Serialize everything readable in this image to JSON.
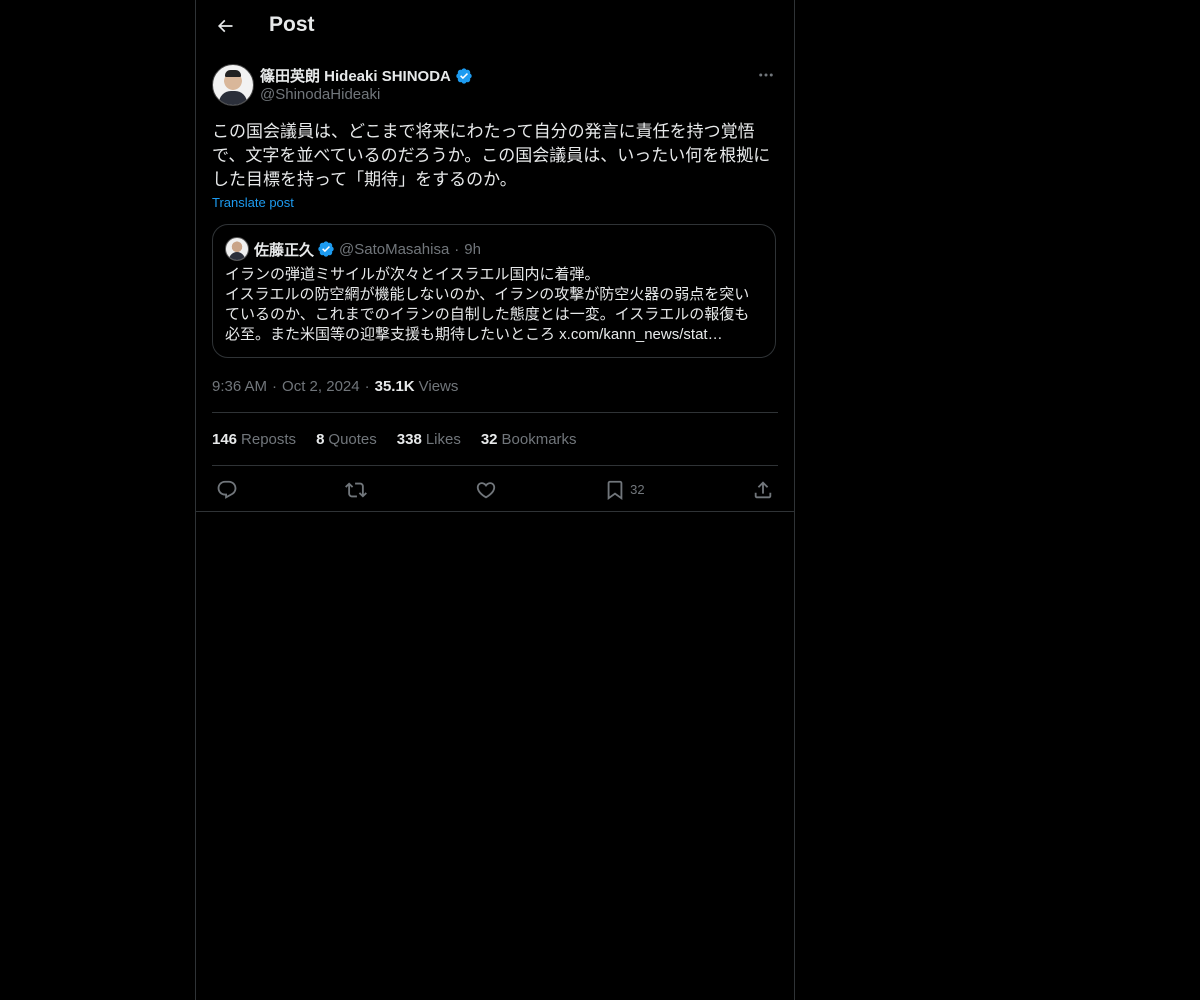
{
  "header": {
    "title": "Post"
  },
  "post": {
    "author_name": "篠田英朗 Hideaki SHINODA",
    "author_handle": "@ShinodaHideaki",
    "text": "この国会議員は、どこまで将来にわたって自分の発言に責任を持つ覚悟で、文字を並べているのだろうか。この国会議員は、いったい何を根拠にした目標を持って「期待」をするのか。",
    "translate_label": "Translate post",
    "time": "9:36 AM",
    "date": "Oct 2, 2024",
    "views_count": "35.1K",
    "views_label": "Views"
  },
  "quote": {
    "author_name": "佐藤正久",
    "author_handle": "@SatoMasahisa",
    "time": "9h",
    "text": "イランの弾道ミサイルが次々とイスラエル国内に着弾。\nイスラエルの防空網が機能しないのか、イランの攻撃が防空火器の弱点を突いているのか、これまでのイランの自制した態度とは一変。イスラエルの報復も必至。また米国等の迎撃支援も期待したいところ x.com/kann_news/stat…"
  },
  "stats": {
    "reposts_count": "146",
    "reposts_label": "Reposts",
    "quotes_count": "8",
    "quotes_label": "Quotes",
    "likes_count": "338",
    "likes_label": "Likes",
    "bookmarks_count": "32",
    "bookmarks_label": "Bookmarks"
  },
  "actions": {
    "bookmark_count": "32"
  },
  "colors": {
    "background": "#000000",
    "text": "#e7e9ea",
    "secondary": "#71767b",
    "accent": "#1d9bf0",
    "border": "#2f3336"
  },
  "icons": {
    "back": "arrow-left-icon",
    "verified": "verified-badge-icon",
    "more": "more-horizontal-icon",
    "reply": "reply-icon",
    "repost": "repost-icon",
    "like": "heart-icon",
    "bookmark": "bookmark-icon",
    "share": "share-icon"
  }
}
